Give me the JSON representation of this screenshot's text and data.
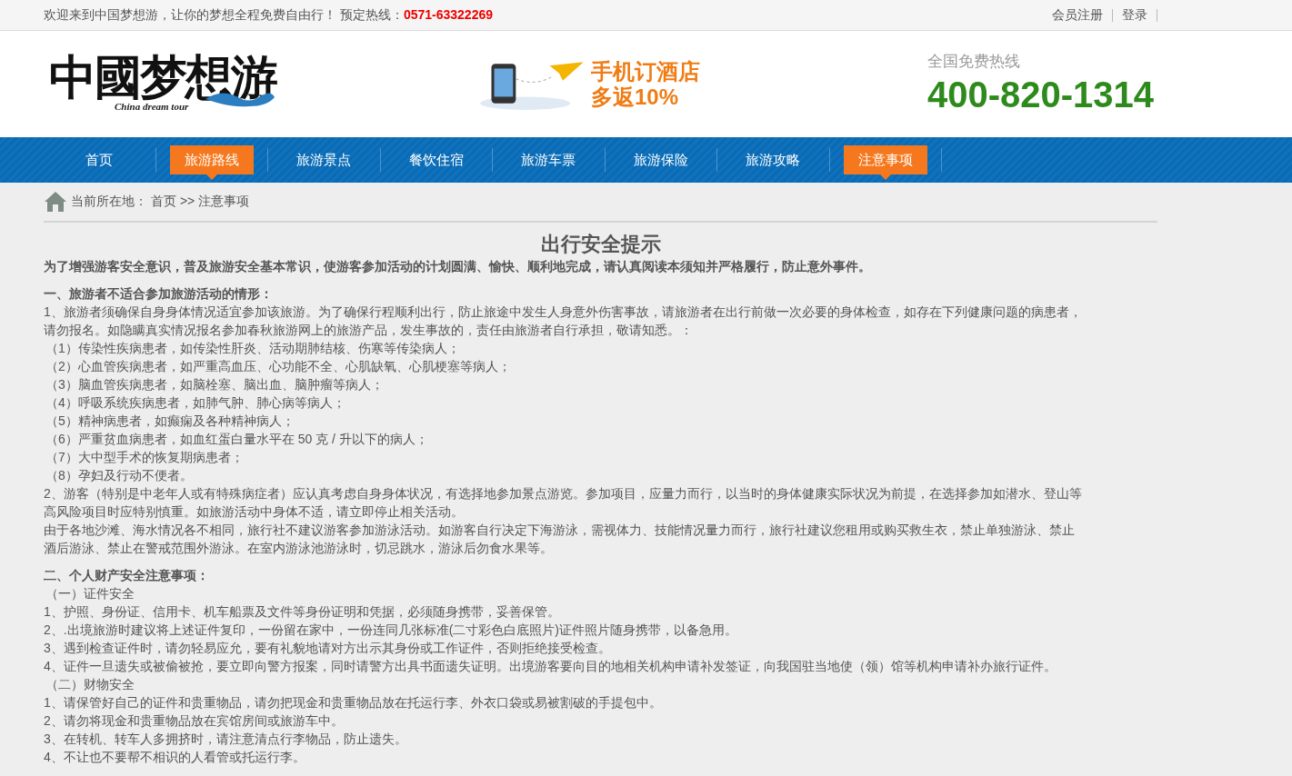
{
  "top_bar": {
    "welcome": "欢迎来到中国梦想游，让你的梦想全程免费自由行！ 预定热线：",
    "hotline": "0571-63322269",
    "links": [
      "会员注册",
      "登录"
    ]
  },
  "header": {
    "logo": {
      "title": "中國梦想游",
      "subtitle": "China dream tour"
    },
    "promo": [
      "手机订酒店",
      "多返10%"
    ],
    "hotline_label": "全国免费热线",
    "hotline_number": "400-820-1314"
  },
  "nav": [
    {
      "label": "首页",
      "selected": false
    },
    {
      "label": "旅游路线",
      "selected": true
    },
    {
      "label": "旅游景点",
      "selected": false
    },
    {
      "label": "餐饮住宿",
      "selected": false
    },
    {
      "label": "旅游车票",
      "selected": false
    },
    {
      "label": "旅游保险",
      "selected": false
    },
    {
      "label": "旅游攻略",
      "selected": false
    },
    {
      "label": "注意事项",
      "selected": true
    }
  ],
  "breadcrumb": {
    "label": "当前所在地：",
    "path": "首页 >> 注意事项"
  },
  "article": {
    "title": "出行安全提示",
    "lines": [
      {
        "kind": "lead",
        "text": "为了增强游客安全意识，普及旅游安全基本常识，使游客参加活动的计划圆满、愉快、顺利地完成，请认真阅读本须知并严格履行，防止意外事件。"
      },
      {
        "kind": "gap"
      },
      {
        "kind": "heading",
        "text": "一、旅游者不适合参加旅游活动的情形："
      },
      {
        "kind": "text",
        "text": "1、旅游者须确保自身身体情况适宜参加该旅游。为了确保行程顺利出行，防止旅途中发生人身意外伤害事故，请旅游者在出行前做一次必要的身体检查，如存在下列健康问题的病患者，"
      },
      {
        "kind": "text",
        "text": "请勿报名。如隐瞒真实情况报名参加春秋旅游网上的旅游产品，发生事故的，责任由旅游者自行承担，敬请知悉。："
      },
      {
        "kind": "sub",
        "text": "（1）传染性疾病患者，如传染性肝炎、活动期肺结核、伤寒等传染病人；"
      },
      {
        "kind": "sub",
        "text": "（2）心血管疾病患者，如严重高血压、心功能不全、心肌缺氧、心肌梗塞等病人；"
      },
      {
        "kind": "sub",
        "text": "（3）脑血管疾病患者，如脑栓塞、脑出血、脑肿瘤等病人；"
      },
      {
        "kind": "sub",
        "text": "（4）呼吸系统疾病患者，如肺气肿、肺心病等病人；"
      },
      {
        "kind": "sub",
        "text": "（5）精神病患者，如癫痫及各种精神病人；"
      },
      {
        "kind": "sub",
        "text": "（6）严重贫血病患者，如血红蛋白量水平在 50 克 / 升以下的病人；"
      },
      {
        "kind": "sub",
        "text": "（7）大中型手术的恢复期病患者；"
      },
      {
        "kind": "sub",
        "text": "（8）孕妇及行动不便者。"
      },
      {
        "kind": "text",
        "text": "2、游客（特别是中老年人或有特殊病症者）应认真考虑自身身体状况，有选择地参加景点游览。参加项目，应量力而行，以当时的身体健康实际状况为前提，在选择参加如潜水、登山等"
      },
      {
        "kind": "text",
        "text": "高风险项目时应特别慎重。如旅游活动中身体不适，请立即停止相关活动。"
      },
      {
        "kind": "text",
        "text": "由于各地沙滩、海水情况各不相同，旅行社不建议游客参加游泳活动。如游客自行决定下海游泳，需视体力、技能情况量力而行，旅行社建议您租用或购买救生衣，禁止单独游泳、禁止"
      },
      {
        "kind": "text",
        "text": "酒后游泳、禁止在警戒范围外游泳。在室内游泳池游泳时，切忌跳水，游泳后勿食水果等。"
      },
      {
        "kind": "gap"
      },
      {
        "kind": "heading",
        "text": "二、个人财产安全注意事项："
      },
      {
        "kind": "sub",
        "text": "（一）证件安全"
      },
      {
        "kind": "text",
        "text": "1、护照、身份证、信用卡、机车船票及文件等身份证明和凭据，必须随身携带，妥善保管。"
      },
      {
        "kind": "text",
        "text": "2、.出境旅游时建议将上述证件复印，一份留在家中，一份连同几张标准(二寸彩色白底照片)证件照片随身携带，以备急用。"
      },
      {
        "kind": "text",
        "text": "3、遇到检查证件时，请勿轻易应允，要有礼貌地请对方出示其身份或工作证件，否则拒绝接受检查。"
      },
      {
        "kind": "text",
        "text": "4、证件一旦遗失或被偷被抢，要立即向警方报案，同时请警方出具书面遗失证明。出境游客要向目的地相关机构申请补发签证，向我国驻当地使（领）馆等机构申请补办旅行证件。"
      },
      {
        "kind": "sub",
        "text": "（二）财物安全"
      },
      {
        "kind": "text",
        "text": "1、请保管好自己的证件和贵重物品，请勿把现金和贵重物品放在托运行李、外衣口袋或易被割破的手提包中。"
      },
      {
        "kind": "text",
        "text": "2、请勿将现金和贵重物品放在宾馆房间或旅游车中。"
      },
      {
        "kind": "text",
        "text": "3、在转机、转车人多拥挤时，请注意清点行李物品，防止遗失。"
      },
      {
        "kind": "text",
        "text": "4、不让也不要帮不相识的人看管或托运行李。"
      }
    ]
  }
}
